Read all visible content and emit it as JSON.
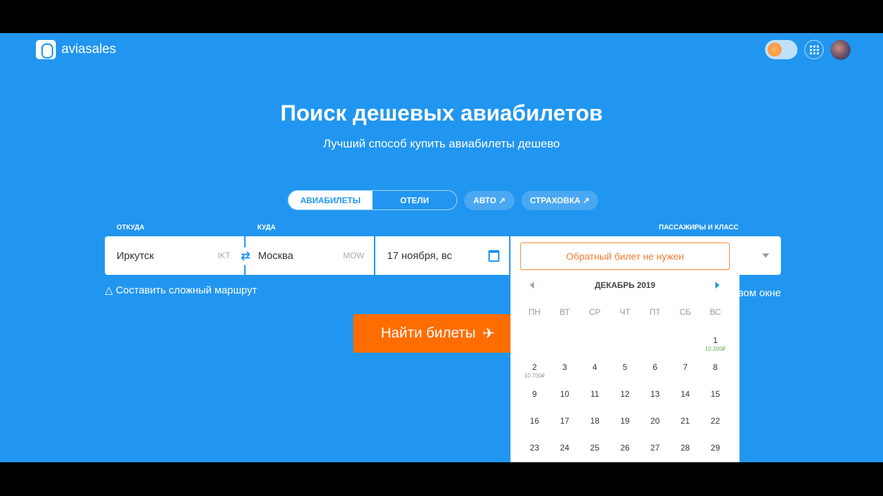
{
  "header": {
    "logo": "aviasales",
    "icons": [
      "theme-toggle",
      "apps-grid",
      "avatar"
    ]
  },
  "hero": {
    "title": "Поиск дешевых авиабилетов",
    "subtitle": "Лучший способ купить авиабилеты дешево"
  },
  "tabs": [
    {
      "label": "АВИАБИЛЕТЫ",
      "active": true
    },
    {
      "label": "ОТЕЛИ"
    }
  ],
  "links": [
    {
      "label": "АВТО ↗"
    },
    {
      "label": "СТРАХОВКА ↗"
    }
  ],
  "form": {
    "from_label": "ОТКУДА",
    "from": "Иркутск",
    "from_code": "IKT",
    "to_label": "КУДА",
    "to": "Москва",
    "to_code": "MOW",
    "date": "17 ноября, вс",
    "passengers_label": "ПАССАЖИРЫ И КЛАСС"
  },
  "route_link": "Составить сложный маршрут",
  "new_window_fragment": "вом окне",
  "search_button": "Найти билеты",
  "calendar": {
    "no_return": "Обратный билет не нужен",
    "month": "ДЕКАБРЬ 2019",
    "weekdays": [
      "ПН",
      "ВТ",
      "СР",
      "ЧТ",
      "ПТ",
      "СБ",
      "ВС"
    ],
    "leading_blanks": 6,
    "days": [
      {
        "d": "1",
        "price": "10 200₽",
        "cheap": true
      },
      {
        "d": "2",
        "price": "10 700₽"
      },
      {
        "d": "3"
      },
      {
        "d": "4"
      },
      {
        "d": "5"
      },
      {
        "d": "6"
      },
      {
        "d": "7"
      },
      {
        "d": "8"
      },
      {
        "d": "9"
      },
      {
        "d": "10"
      },
      {
        "d": "11"
      },
      {
        "d": "12"
      },
      {
        "d": "13"
      },
      {
        "d": "14"
      },
      {
        "d": "15"
      },
      {
        "d": "16"
      },
      {
        "d": "17"
      },
      {
        "d": "18"
      },
      {
        "d": "19"
      },
      {
        "d": "20"
      },
      {
        "d": "21"
      },
      {
        "d": "22"
      },
      {
        "d": "23"
      },
      {
        "d": "24"
      },
      {
        "d": "25"
      },
      {
        "d": "26"
      },
      {
        "d": "27"
      },
      {
        "d": "28"
      },
      {
        "d": "29"
      }
    ]
  },
  "colors": {
    "brand": "#2196f0",
    "accent": "#ff6d00"
  }
}
